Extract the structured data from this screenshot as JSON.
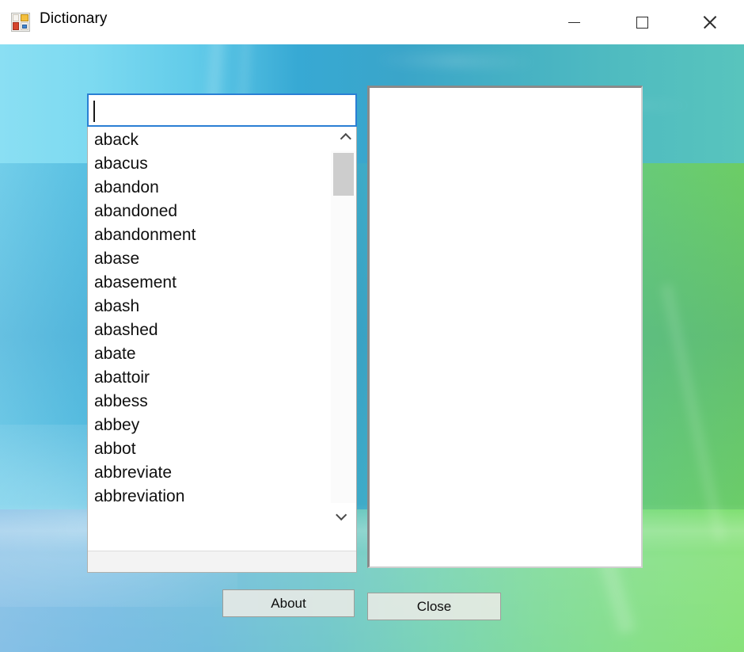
{
  "window": {
    "title": "Dictionary",
    "icon": "winforms-app-icon",
    "controls": {
      "minimize": "minimize-icon",
      "maximize": "maximize-icon",
      "close": "close-icon"
    }
  },
  "search": {
    "value": "",
    "placeholder": "",
    "focused": true,
    "accent_color": "#2a7fd4"
  },
  "word_list": {
    "items": [
      "aback",
      "abacus",
      "abandon",
      "abandoned",
      "abandonment",
      "abase",
      "abasement",
      "abash",
      "abashed",
      "abate",
      "abattoir",
      "abbess",
      "abbey",
      "abbot",
      "abbreviate",
      "abbreviation"
    ],
    "selected": null,
    "scrollbar": {
      "up_arrow": "chevron-up-icon",
      "down_arrow": "chevron-down-icon",
      "thumb_position": "top"
    }
  },
  "definition_panel": {
    "text": "",
    "background_color": "#ffffff"
  },
  "buttons": {
    "about": "About",
    "close": "Close"
  }
}
